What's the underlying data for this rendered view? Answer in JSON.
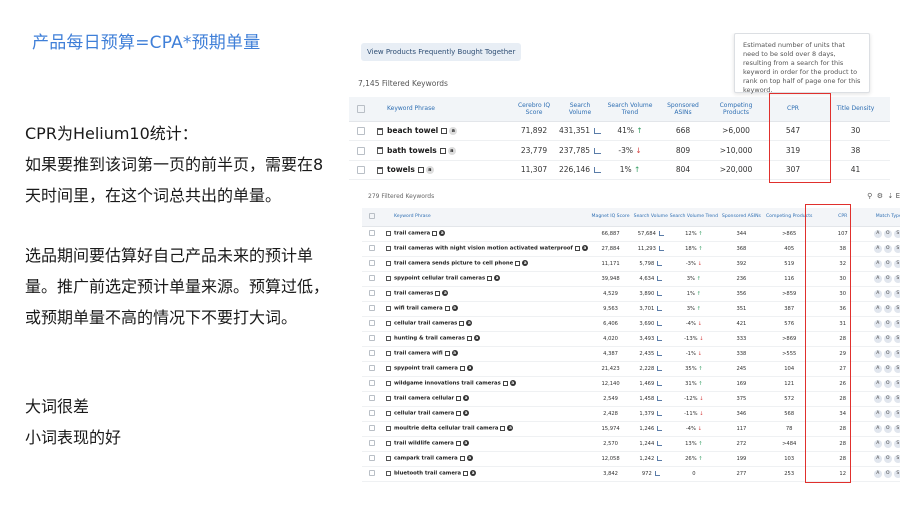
{
  "slide": {
    "title": "产品每日预算=CPA*预期单量",
    "notes_1": [
      "CPR为Helium10统计：",
      "如果要推到该词第一页的前半页，需要在8",
      "天时间里，在这个词总共出的单量。"
    ],
    "notes_2": [
      "选品期间要估算好自己产品未来的预计单",
      "量。推广前选定预计单量来源。预算过低，",
      "或预期单量不高的情况下不要打大词。"
    ],
    "notes_3": [
      "大词很差",
      "小词表现的好"
    ]
  },
  "top_panel": {
    "vfbt_button": "View Products Frequently Bought Together",
    "filtered_count": "7,145 Filtered Keywords",
    "tooltip": "Estimated number of units that need to be sold over 8 days, resulting from a search for this keyword in order for the product to rank on top half of page one for this keyword.",
    "headers": [
      "Keyword Phrase",
      "Cerebro IQ Score",
      "Search Volume",
      "Search Volume Trend",
      "Sponsored ASINs",
      "Competing Products",
      "CPR",
      "Title Density"
    ],
    "rows": [
      {
        "keyword": "beach towel",
        "iq": "71,892",
        "volume": "431,351",
        "trend": "41%",
        "trend_dir": "up",
        "sponsored": "668",
        "competing": ">6,000",
        "cpr": "547",
        "density": "30"
      },
      {
        "keyword": "bath towels",
        "iq": "23,779",
        "volume": "237,785",
        "trend": "-3%",
        "trend_dir": "down",
        "sponsored": "809",
        "competing": ">10,000",
        "cpr": "319",
        "density": "38"
      },
      {
        "keyword": "towels",
        "iq": "11,307",
        "volume": "226,146",
        "trend": "1%",
        "trend_dir": "up",
        "sponsored": "804",
        "competing": ">20,000",
        "cpr": "307",
        "density": "41"
      }
    ]
  },
  "bottom_panel": {
    "filtered_count": "279 Filtered Keywords",
    "tools_label": "E",
    "headers": [
      "Keyword Phrase",
      "Magnet IQ Score",
      "Search Volume",
      "Search Volume Trend",
      "Sponsored ASINs",
      "Competing Products",
      "CPR",
      "Match Type"
    ],
    "match_labels": [
      "A",
      "O",
      "S"
    ],
    "rows": [
      {
        "keyword": "trail camera",
        "iq": "66,887",
        "volume": "57,684",
        "trend": "12%",
        "trend_dir": "up",
        "sponsored": "344",
        "competing": ">865",
        "cpr": "107",
        "match": "A"
      },
      {
        "keyword": "trail cameras with night vision motion activated waterproof",
        "iq": "27,884",
        "volume": "11,293",
        "trend": "18%",
        "trend_dir": "up",
        "sponsored": "368",
        "competing": "405",
        "cpr": "38",
        "match": "A"
      },
      {
        "keyword": "trail camera sends picture to cell phone",
        "iq": "11,171",
        "volume": "5,798",
        "trend": "-3%",
        "trend_dir": "down",
        "sponsored": "392",
        "competing": "519",
        "cpr": "32",
        "match": "A"
      },
      {
        "keyword": "spypoint cellular trail cameras",
        "iq": "39,948",
        "volume": "4,634",
        "trend": "3%",
        "trend_dir": "up",
        "sponsored": "236",
        "competing": "116",
        "cpr": "30",
        "match": "A"
      },
      {
        "keyword": "trail cameras",
        "iq": "4,529",
        "volume": "3,890",
        "trend": "1%",
        "trend_dir": "up",
        "sponsored": "356",
        "competing": ">859",
        "cpr": "30",
        "match": "A"
      },
      {
        "keyword": "wifi trail camera",
        "iq": "9,563",
        "volume": "3,701",
        "trend": "3%",
        "trend_dir": "up",
        "sponsored": "351",
        "competing": "387",
        "cpr": "36",
        "match": "A"
      },
      {
        "keyword": "cellular trail cameras",
        "iq": "6,406",
        "volume": "3,690",
        "trend": "-4%",
        "trend_dir": "down",
        "sponsored": "421",
        "competing": "576",
        "cpr": "31",
        "match": "A"
      },
      {
        "keyword": "hunting & trail cameras",
        "iq": "4,020",
        "volume": "3,493",
        "trend": "-13%",
        "trend_dir": "down",
        "sponsored": "333",
        "competing": ">869",
        "cpr": "28",
        "match": "A"
      },
      {
        "keyword": "trail camera wifi",
        "iq": "4,387",
        "volume": "2,435",
        "trend": "-1%",
        "trend_dir": "down",
        "sponsored": "338",
        "competing": ">555",
        "cpr": "29",
        "match": "A"
      },
      {
        "keyword": "spypoint trail camera",
        "iq": "21,423",
        "volume": "2,228",
        "trend": "35%",
        "trend_dir": "up",
        "sponsored": "245",
        "competing": "104",
        "cpr": "27",
        "match": "A"
      },
      {
        "keyword": "wildgame innovations trail cameras",
        "iq": "12,140",
        "volume": "1,469",
        "trend": "31%",
        "trend_dir": "up",
        "sponsored": "169",
        "competing": "121",
        "cpr": "26",
        "match": "A"
      },
      {
        "keyword": "trail camera cellular",
        "iq": "2,549",
        "volume": "1,458",
        "trend": "-12%",
        "trend_dir": "down",
        "sponsored": "375",
        "competing": "572",
        "cpr": "28",
        "match": "A"
      },
      {
        "keyword": "cellular trail camera",
        "iq": "2,428",
        "volume": "1,379",
        "trend": "-11%",
        "trend_dir": "down",
        "sponsored": "346",
        "competing": "568",
        "cpr": "34",
        "match": "A"
      },
      {
        "keyword": "moultrie delta cellular trail camera",
        "iq": "15,974",
        "volume": "1,246",
        "trend": "-4%",
        "trend_dir": "down",
        "sponsored": "117",
        "competing": "78",
        "cpr": "28",
        "match": "A"
      },
      {
        "keyword": "trail wildlife camera",
        "iq": "2,570",
        "volume": "1,244",
        "trend": "13%",
        "trend_dir": "up",
        "sponsored": "272",
        "competing": ">484",
        "cpr": "28",
        "match": "A"
      },
      {
        "keyword": "campark trail camera",
        "iq": "12,058",
        "volume": "1,242",
        "trend": "26%",
        "trend_dir": "up",
        "sponsored": "199",
        "competing": "103",
        "cpr": "28",
        "match": "A"
      },
      {
        "keyword": "bluetooth trail camera",
        "iq": "3,842",
        "volume": "972",
        "trend": "0",
        "trend_dir": "none",
        "sponsored": "277",
        "competing": "253",
        "cpr": "12",
        "match": "A"
      }
    ]
  },
  "colors": {
    "accent": "#3f7fd8",
    "highlight": "#e0302d",
    "up": "#2e9a5e",
    "down": "#d64545"
  }
}
